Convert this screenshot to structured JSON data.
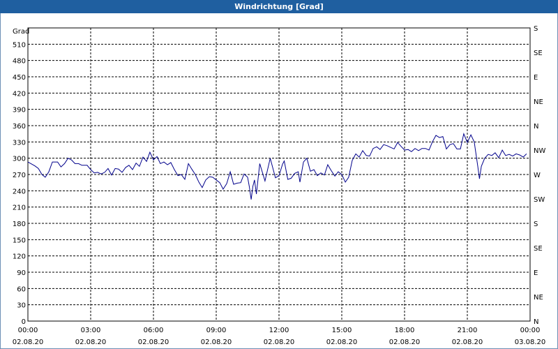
{
  "title": "Windrichtung [Grad]",
  "chart_data": {
    "type": "line",
    "ylabel": "Grad",
    "ylim": [
      0,
      540
    ],
    "y_ticks": [
      0,
      30,
      60,
      90,
      120,
      150,
      180,
      210,
      240,
      270,
      300,
      330,
      360,
      390,
      420,
      450,
      480,
      510
    ],
    "right_axis_labels": [
      {
        "value": 0,
        "label": "N"
      },
      {
        "value": 45,
        "label": "NE"
      },
      {
        "value": 90,
        "label": "E"
      },
      {
        "value": 135,
        "label": "SE"
      },
      {
        "value": 180,
        "label": "S"
      },
      {
        "value": 225,
        "label": "SW"
      },
      {
        "value": 270,
        "label": "W"
      },
      {
        "value": 315,
        "label": "NW"
      },
      {
        "value": 360,
        "label": "N"
      },
      {
        "value": 405,
        "label": "NE"
      },
      {
        "value": 450,
        "label": "E"
      },
      {
        "value": 495,
        "label": "SE"
      },
      {
        "value": 540,
        "label": "S"
      }
    ],
    "x_ticks": [
      {
        "time": "00:00",
        "date": "02.08.20"
      },
      {
        "time": "03:00",
        "date": "02.08.20"
      },
      {
        "time": "06:00",
        "date": "02.08.20"
      },
      {
        "time": "09:00",
        "date": "02.08.20"
      },
      {
        "time": "12:00",
        "date": "02.08.20"
      },
      {
        "time": "15:00",
        "date": "02.08.20"
      },
      {
        "time": "18:00",
        "date": "02.08.20"
      },
      {
        "time": "21:00",
        "date": "02.08.20"
      },
      {
        "time": "00:00",
        "date": "03.08.20"
      }
    ],
    "xlim_hours": [
      0,
      24
    ],
    "grid": true,
    "color": "#00008b",
    "series": [
      {
        "points": [
          [
            0.0,
            293
          ],
          [
            0.33,
            286
          ],
          [
            0.5,
            281
          ],
          [
            0.67,
            270
          ],
          [
            0.83,
            265
          ],
          [
            1.0,
            275
          ],
          [
            1.17,
            293
          ],
          [
            1.42,
            293
          ],
          [
            1.58,
            284
          ],
          [
            1.75,
            290
          ],
          [
            1.92,
            300
          ],
          [
            2.08,
            297
          ],
          [
            2.25,
            290
          ],
          [
            2.42,
            290
          ],
          [
            2.58,
            287
          ],
          [
            2.83,
            287
          ],
          [
            3.0,
            279
          ],
          [
            3.17,
            273
          ],
          [
            3.33,
            274
          ],
          [
            3.5,
            271
          ],
          [
            3.67,
            274
          ],
          [
            3.83,
            281
          ],
          [
            4.0,
            269
          ],
          [
            4.17,
            281
          ],
          [
            4.33,
            280
          ],
          [
            4.5,
            274
          ],
          [
            4.67,
            283
          ],
          [
            4.83,
            287
          ],
          [
            5.0,
            279
          ],
          [
            5.17,
            291
          ],
          [
            5.33,
            285
          ],
          [
            5.5,
            302
          ],
          [
            5.67,
            294
          ],
          [
            5.83,
            311
          ],
          [
            6.0,
            297
          ],
          [
            6.17,
            303
          ],
          [
            6.33,
            290
          ],
          [
            6.5,
            293
          ],
          [
            6.67,
            288
          ],
          [
            6.83,
            292
          ],
          [
            7.0,
            279
          ],
          [
            7.17,
            268
          ],
          [
            7.33,
            270
          ],
          [
            7.5,
            261
          ],
          [
            7.67,
            290
          ],
          [
            7.83,
            280
          ],
          [
            8.0,
            270
          ],
          [
            8.17,
            256
          ],
          [
            8.33,
            246
          ],
          [
            8.5,
            260
          ],
          [
            8.67,
            266
          ],
          [
            8.83,
            265
          ],
          [
            9.0,
            260
          ],
          [
            9.17,
            255
          ],
          [
            9.33,
            243
          ],
          [
            9.5,
            253
          ],
          [
            9.67,
            275
          ],
          [
            9.83,
            252
          ],
          [
            10.0,
            254
          ],
          [
            10.17,
            255
          ],
          [
            10.33,
            271
          ],
          [
            10.5,
            265
          ],
          [
            10.58,
            248
          ],
          [
            10.67,
            224
          ],
          [
            10.75,
            248
          ],
          [
            10.83,
            260
          ],
          [
            10.92,
            234
          ],
          [
            11.08,
            290
          ],
          [
            11.33,
            258
          ],
          [
            11.58,
            300
          ],
          [
            11.83,
            264
          ],
          [
            12.0,
            268
          ],
          [
            12.17,
            289
          ],
          [
            12.25,
            295
          ],
          [
            12.42,
            261
          ],
          [
            12.58,
            263
          ],
          [
            12.75,
            272
          ],
          [
            12.92,
            275
          ],
          [
            13.0,
            256
          ],
          [
            13.17,
            293
          ],
          [
            13.33,
            300
          ],
          [
            13.5,
            276
          ],
          [
            13.67,
            279
          ],
          [
            13.83,
            268
          ],
          [
            14.0,
            273
          ],
          [
            14.17,
            269
          ],
          [
            14.33,
            288
          ],
          [
            14.5,
            277
          ],
          [
            14.67,
            267
          ],
          [
            14.83,
            275
          ],
          [
            15.0,
            270
          ],
          [
            15.17,
            256
          ],
          [
            15.33,
            265
          ],
          [
            15.5,
            296
          ],
          [
            15.67,
            308
          ],
          [
            15.83,
            302
          ],
          [
            16.0,
            314
          ],
          [
            16.17,
            305
          ],
          [
            16.33,
            304
          ],
          [
            16.5,
            318
          ],
          [
            16.67,
            321
          ],
          [
            16.83,
            316
          ],
          [
            17.0,
            325
          ],
          [
            17.17,
            323
          ],
          [
            17.33,
            320
          ],
          [
            17.5,
            317
          ],
          [
            17.67,
            329
          ],
          [
            17.83,
            322
          ],
          [
            18.0,
            315
          ],
          [
            18.17,
            316
          ],
          [
            18.33,
            312
          ],
          [
            18.5,
            318
          ],
          [
            18.67,
            314
          ],
          [
            18.83,
            318
          ],
          [
            19.0,
            318
          ],
          [
            19.17,
            315
          ],
          [
            19.33,
            330
          ],
          [
            19.5,
            342
          ],
          [
            19.67,
            338
          ],
          [
            19.83,
            340
          ],
          [
            20.0,
            317
          ],
          [
            20.17,
            325
          ],
          [
            20.33,
            327
          ],
          [
            20.5,
            317
          ],
          [
            20.67,
            317
          ],
          [
            20.83,
            345
          ],
          [
            21.0,
            329
          ],
          [
            21.17,
            343
          ],
          [
            21.33,
            330
          ],
          [
            21.5,
            285
          ],
          [
            21.58,
            262
          ],
          [
            21.67,
            285
          ],
          [
            21.83,
            300
          ],
          [
            22.0,
            307
          ],
          [
            22.17,
            305
          ],
          [
            22.33,
            310
          ],
          [
            22.5,
            301
          ],
          [
            22.67,
            315
          ],
          [
            22.83,
            305
          ],
          [
            23.0,
            307
          ],
          [
            23.17,
            304
          ],
          [
            23.33,
            308
          ],
          [
            23.5,
            306
          ],
          [
            23.67,
            302
          ],
          [
            23.83,
            308
          ]
        ]
      }
    ]
  }
}
